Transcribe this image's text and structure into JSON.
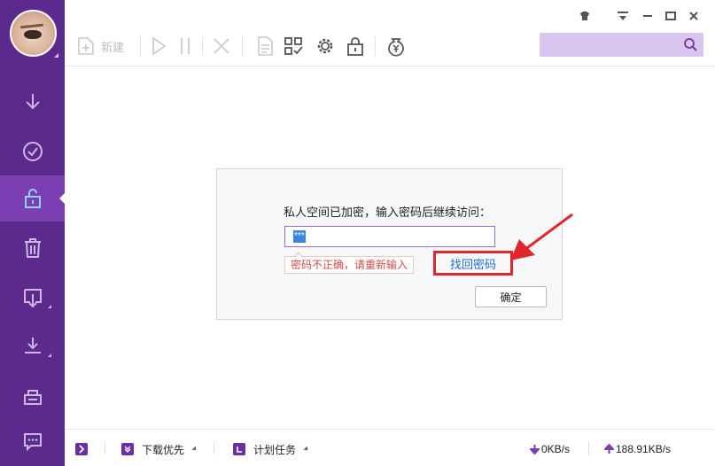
{
  "colors": {
    "sidebar": "#5c2a8d",
    "sidebar_active": "#7b3fb3",
    "accent": "#6a2fa3",
    "search_bg": "#d9c5f0",
    "link": "#1f6fd1",
    "error": "#d24b4b",
    "highlight_box": "#e0262b"
  },
  "sidebar": {
    "avatar_icon": "user-avatar",
    "items": [
      {
        "icon": "download-arrow-icon",
        "active": false
      },
      {
        "icon": "check-circle-icon",
        "active": false
      },
      {
        "icon": "unlock-icon",
        "active": true
      },
      {
        "icon": "trash-icon",
        "active": false
      },
      {
        "icon": "download-box-icon",
        "active": false
      },
      {
        "icon": "download-tray-icon",
        "active": false
      },
      {
        "icon": "print-icon",
        "active": false
      },
      {
        "icon": "chat-bubble-icon",
        "active": false
      }
    ]
  },
  "toolbar": {
    "new_label": "新建",
    "icons": [
      "new-file-icon",
      "play-icon",
      "pause-icon",
      "delete-x-icon",
      "document-icon",
      "grid-check-icon",
      "gear-icon",
      "lock-icon",
      "money-bag-icon"
    ],
    "window_controls": [
      "skin-icon",
      "menu-icon",
      "minimize-icon",
      "maximize-icon",
      "close-icon"
    ],
    "search_icon": "search-icon"
  },
  "dialog": {
    "message": "私人空间已加密，输入密码后继续访问：",
    "password_value": "***",
    "error_text": "密码不正确，请重新输入",
    "recover_link": "找回密码",
    "confirm_label": "确定"
  },
  "statusbar": {
    "download_priority_label": "下载优先",
    "scheduled_tasks_label": "计划任务",
    "download_speed": "0KB/s",
    "upload_speed": "188.91KB/s"
  }
}
